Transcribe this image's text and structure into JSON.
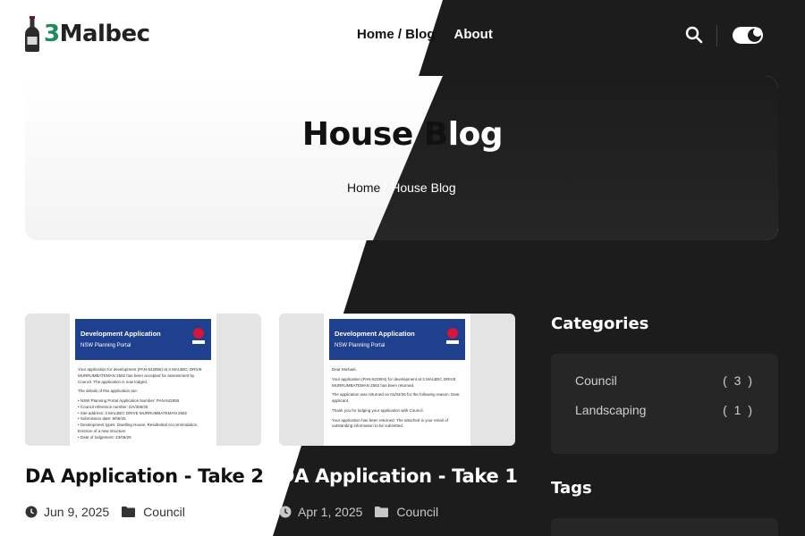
{
  "brand": {
    "name_num": "3",
    "name_text": "Malbec"
  },
  "nav": {
    "home_blog": "Home / Blog",
    "about": "About"
  },
  "hero": {
    "title_left": "House B",
    "title_right": "log",
    "crumb_home": "Home",
    "crumb_sep": "/",
    "crumb_current": "House Blog"
  },
  "posts": [
    {
      "title": "DA Application - Take 2",
      "date": "Jun 9, 2025",
      "category": "Council",
      "doc_title": "Development Application",
      "doc_subtitle": "NSW Planning Portal",
      "doc_lines": [
        "Your application for development (PAN-542855) at 3 MALBEC DRIVE MURRUMBATEMAN 2582 has been accepted for assessment by Council. The application is now lodged.",
        "The details of this application are:",
        "• NSW Planning Portal Application Number: PAN-542855",
        "• Council reference number: DA/306/25",
        "• Site address: 3 MALBEC DRIVE MURRUMBATEMAN 2582",
        "• Submission date: 9/06/25",
        "• Development types: Dwelling House, Residential Accommodation, Erection of a new structure",
        "• Date of lodgement: 23/06/25"
      ]
    },
    {
      "title": "DA Application - Take 1",
      "date": "Apr 1, 2025",
      "category": "Council",
      "doc_title": "Development Application",
      "doc_subtitle": "NSW Planning Portal",
      "doc_lines": [
        "Dear Michael,",
        "Your application (PAN-522904) for development at 3 MALBEC DRIVE MURRUMBATEMAN 2582 has been returned.",
        "The application was returned on 01/04/25 for the following reason: Dear applicant,",
        "Thank you for lodging your application with Council.",
        "Your application has been returned. The attached is your email of outstanding information to be submitted."
      ]
    }
  ],
  "sidebar": {
    "categories_title": "Categories",
    "categories": [
      {
        "name": "Council",
        "count": "( 3 )"
      },
      {
        "name": "Landscaping",
        "count": "( 1 )"
      }
    ],
    "tags_title": "Tags"
  },
  "colors": {
    "dark": "#1c1c1c",
    "panel": "#262626",
    "brand_green": "#1f8a5b",
    "doc_blue": "#1f3f8f"
  }
}
